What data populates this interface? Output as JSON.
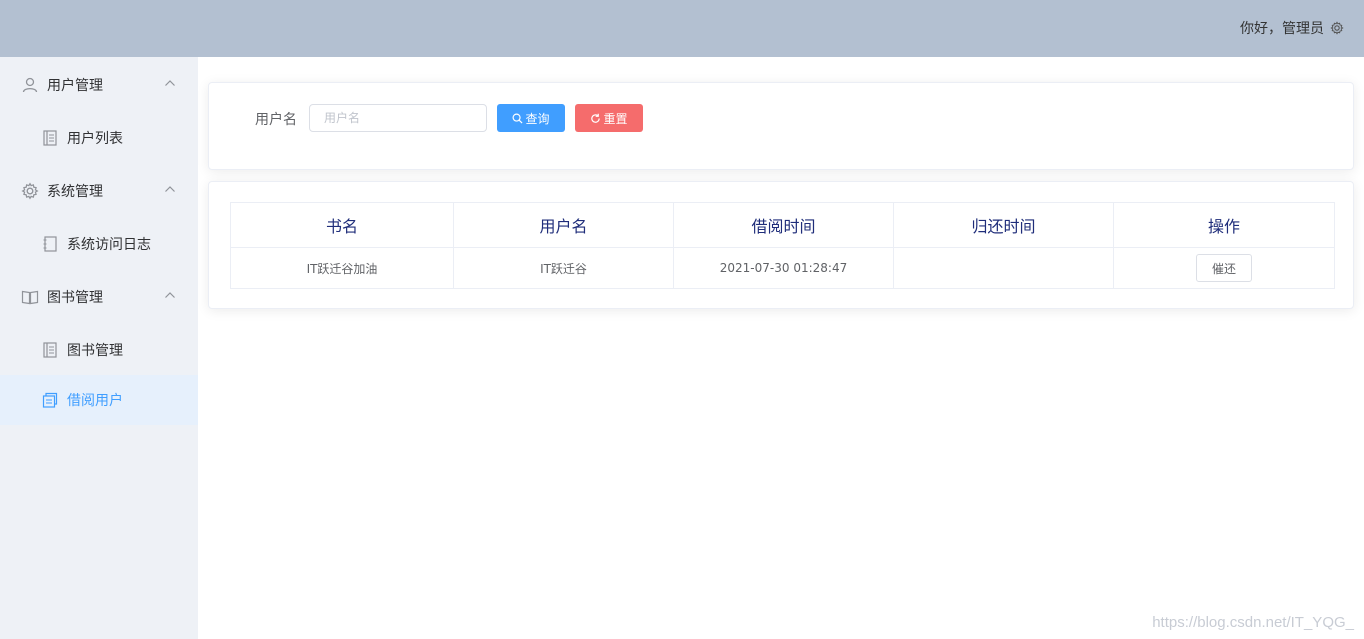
{
  "header": {
    "greeting": "你好，管理员",
    "settings_icon": "gear-icon"
  },
  "sidebar": {
    "groups": [
      {
        "label": "用户管理",
        "icon": "user-icon",
        "items": [
          {
            "label": "用户列表",
            "icon": "document-icon"
          }
        ]
      },
      {
        "label": "系统管理",
        "icon": "gear-icon",
        "items": [
          {
            "label": "系统访问日志",
            "icon": "notebook-icon"
          }
        ]
      },
      {
        "label": "图书管理",
        "icon": "book-icon",
        "items": [
          {
            "label": "图书管理",
            "icon": "document-icon"
          },
          {
            "label": "借阅用户",
            "icon": "tickets-icon",
            "active": true
          }
        ]
      }
    ]
  },
  "search": {
    "label": "用户名",
    "placeholder": "用户名",
    "value": "",
    "query_label": "查询",
    "reset_label": "重置"
  },
  "table": {
    "columns": [
      "书名",
      "用户名",
      "借阅时间",
      "归还时间",
      "操作"
    ],
    "rows": [
      {
        "book": "IT跃迁谷加油",
        "user": "IT跃迁谷",
        "borrow_time": "2021-07-30 01:28:47",
        "return_time": "",
        "action": "催还"
      }
    ]
  },
  "watermark": "https://blog.csdn.net/IT_YQG_",
  "colors": {
    "header_bg": "#b3c0d1",
    "sidebar_bg": "#eef1f6",
    "primary": "#409eff",
    "danger": "#f56c6c",
    "active_item_bg": "#e6f0fc"
  }
}
